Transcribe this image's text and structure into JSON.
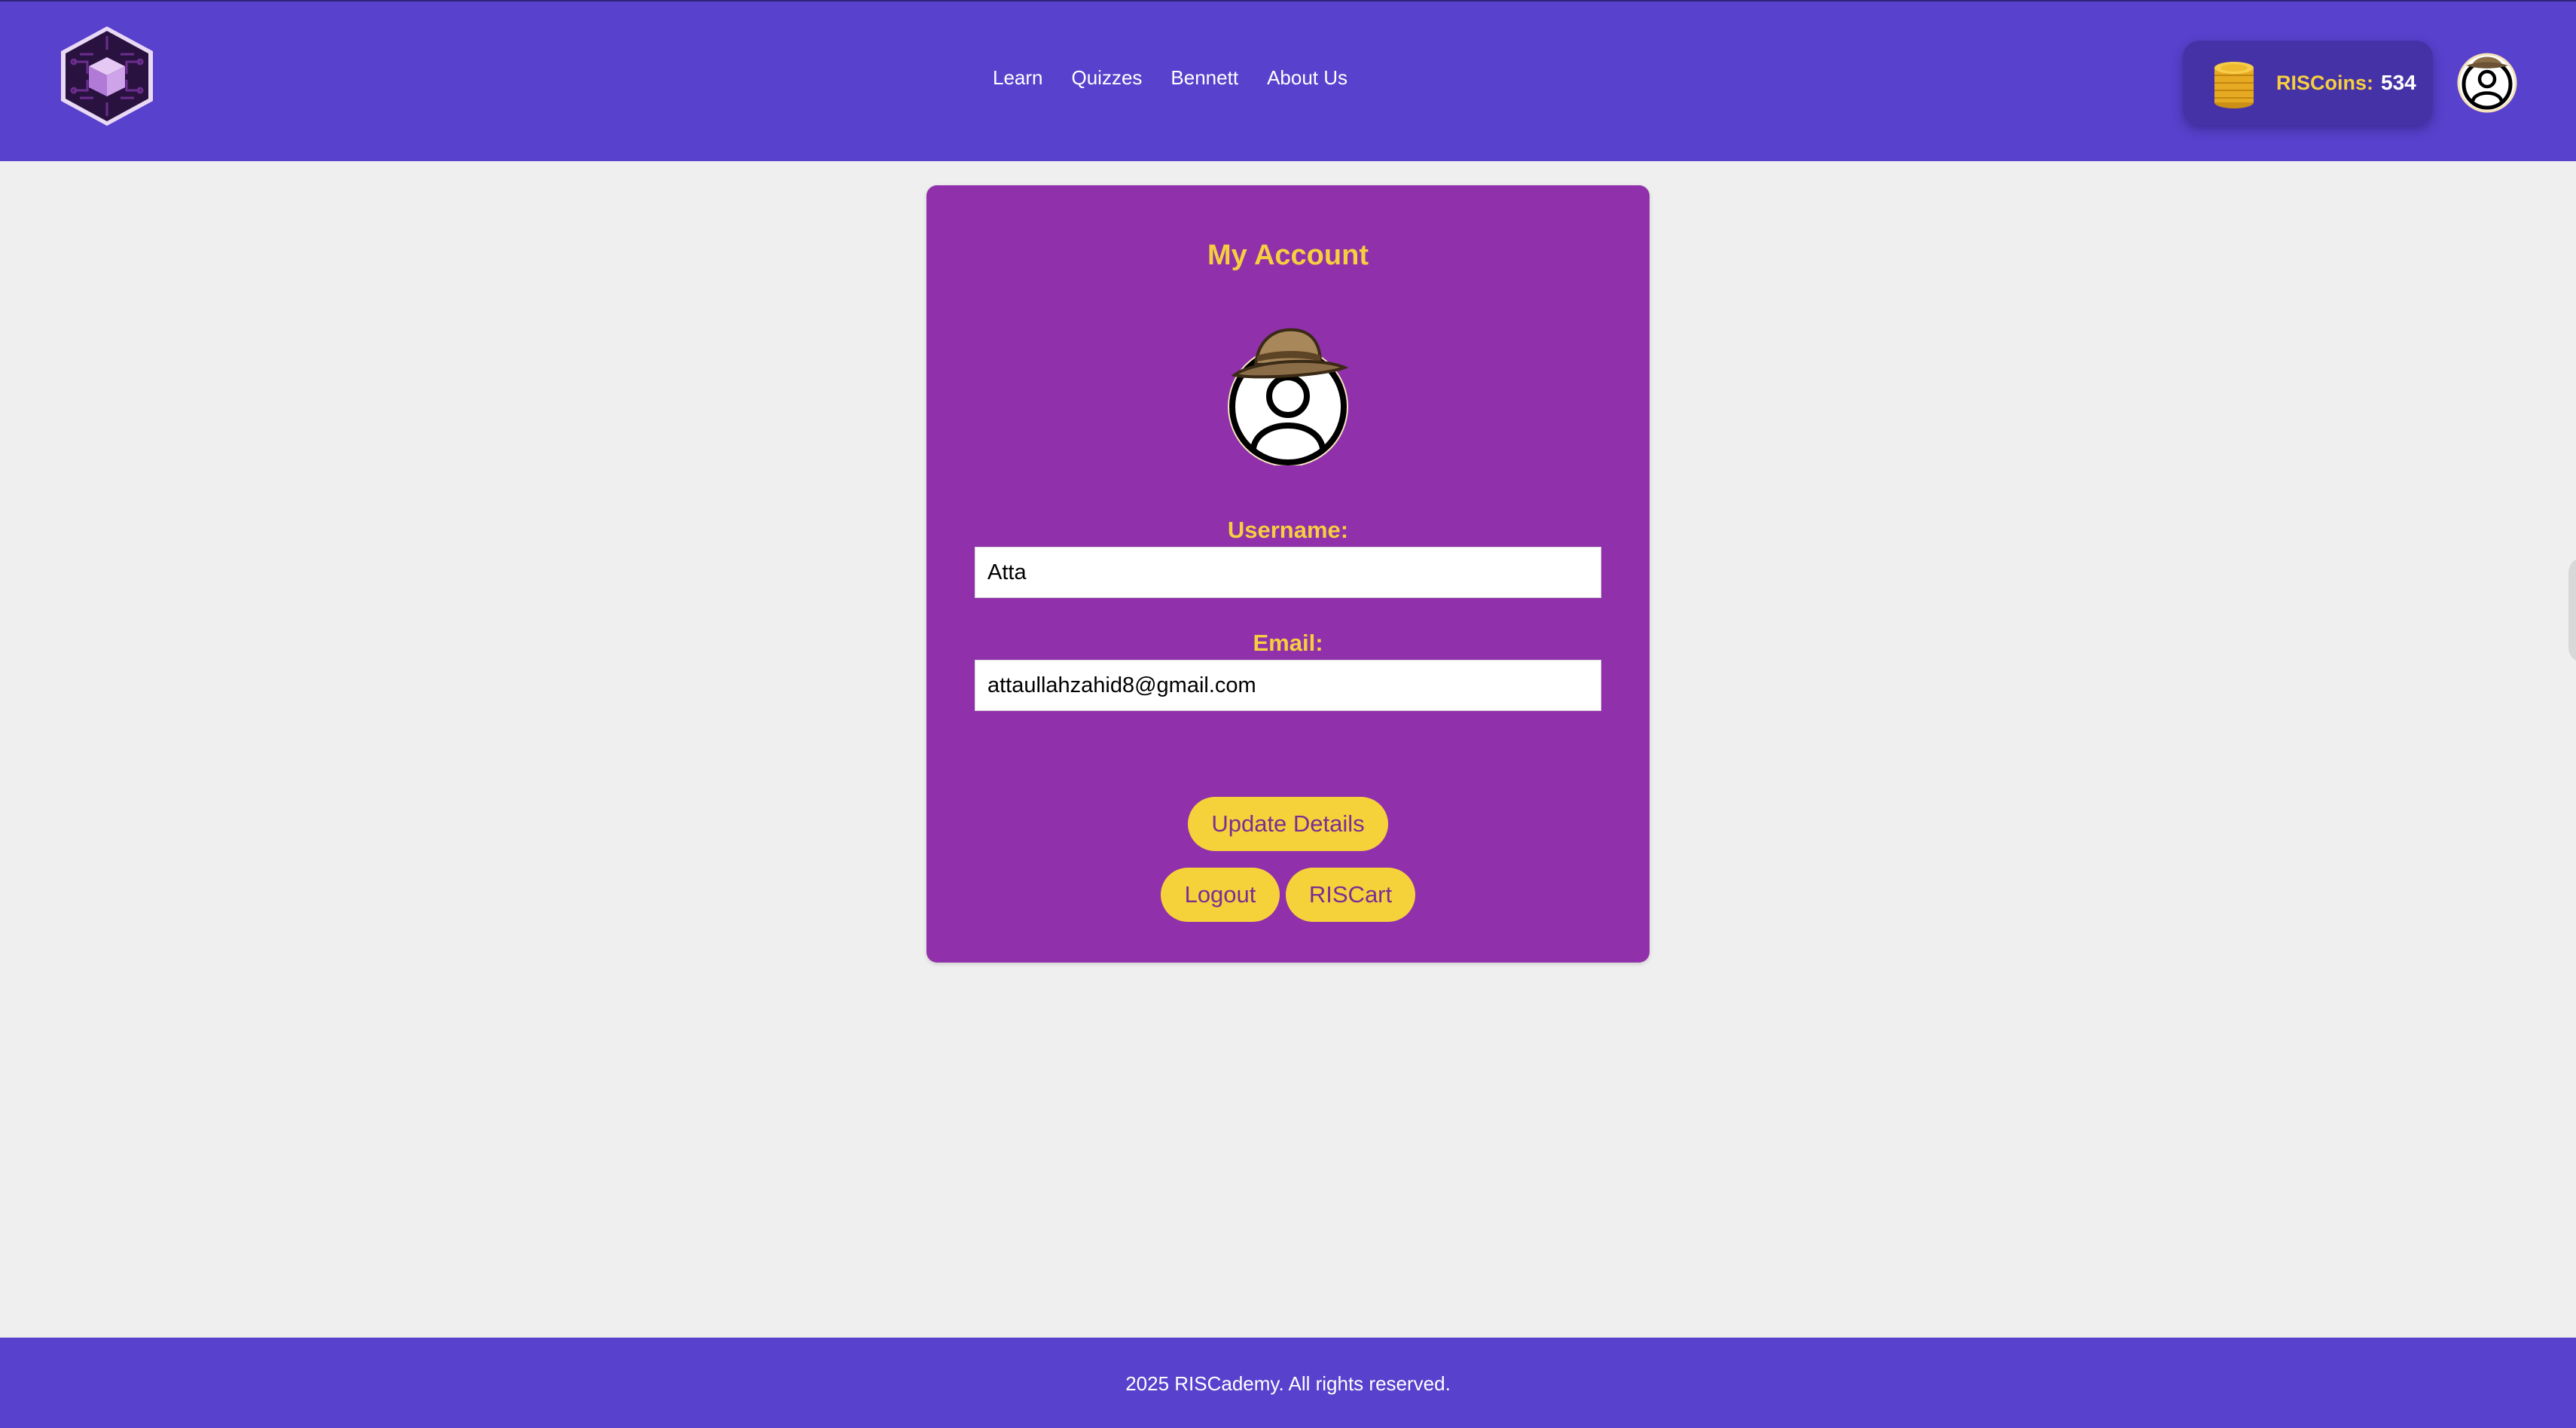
{
  "header": {
    "logo_icon": "hexagon-cube-logo",
    "nav": [
      {
        "label": "Learn"
      },
      {
        "label": "Quizzes"
      },
      {
        "label": "Bennett"
      },
      {
        "label": "About Us"
      }
    ],
    "coins": {
      "icon": "coin-stack-icon",
      "label": "RISCoins:",
      "value": "534"
    },
    "avatar_icon": "user-with-hat-avatar"
  },
  "account": {
    "title": "My Account",
    "avatar_icon": "user-with-hat-avatar",
    "username_label": "Username:",
    "username_value": "Atta",
    "email_label": "Email:",
    "email_value": "attaullahzahid8@gmail.com",
    "update_button": "Update Details",
    "logout_button": "Logout",
    "cart_button": "RISCart"
  },
  "footer": {
    "text": "2025 RISCademy. All rights reserved."
  },
  "colors": {
    "header_bg": "#5841cc",
    "card_bg": "#9030aa",
    "accent_yellow": "#f5cf3f",
    "page_bg": "#efefef"
  }
}
